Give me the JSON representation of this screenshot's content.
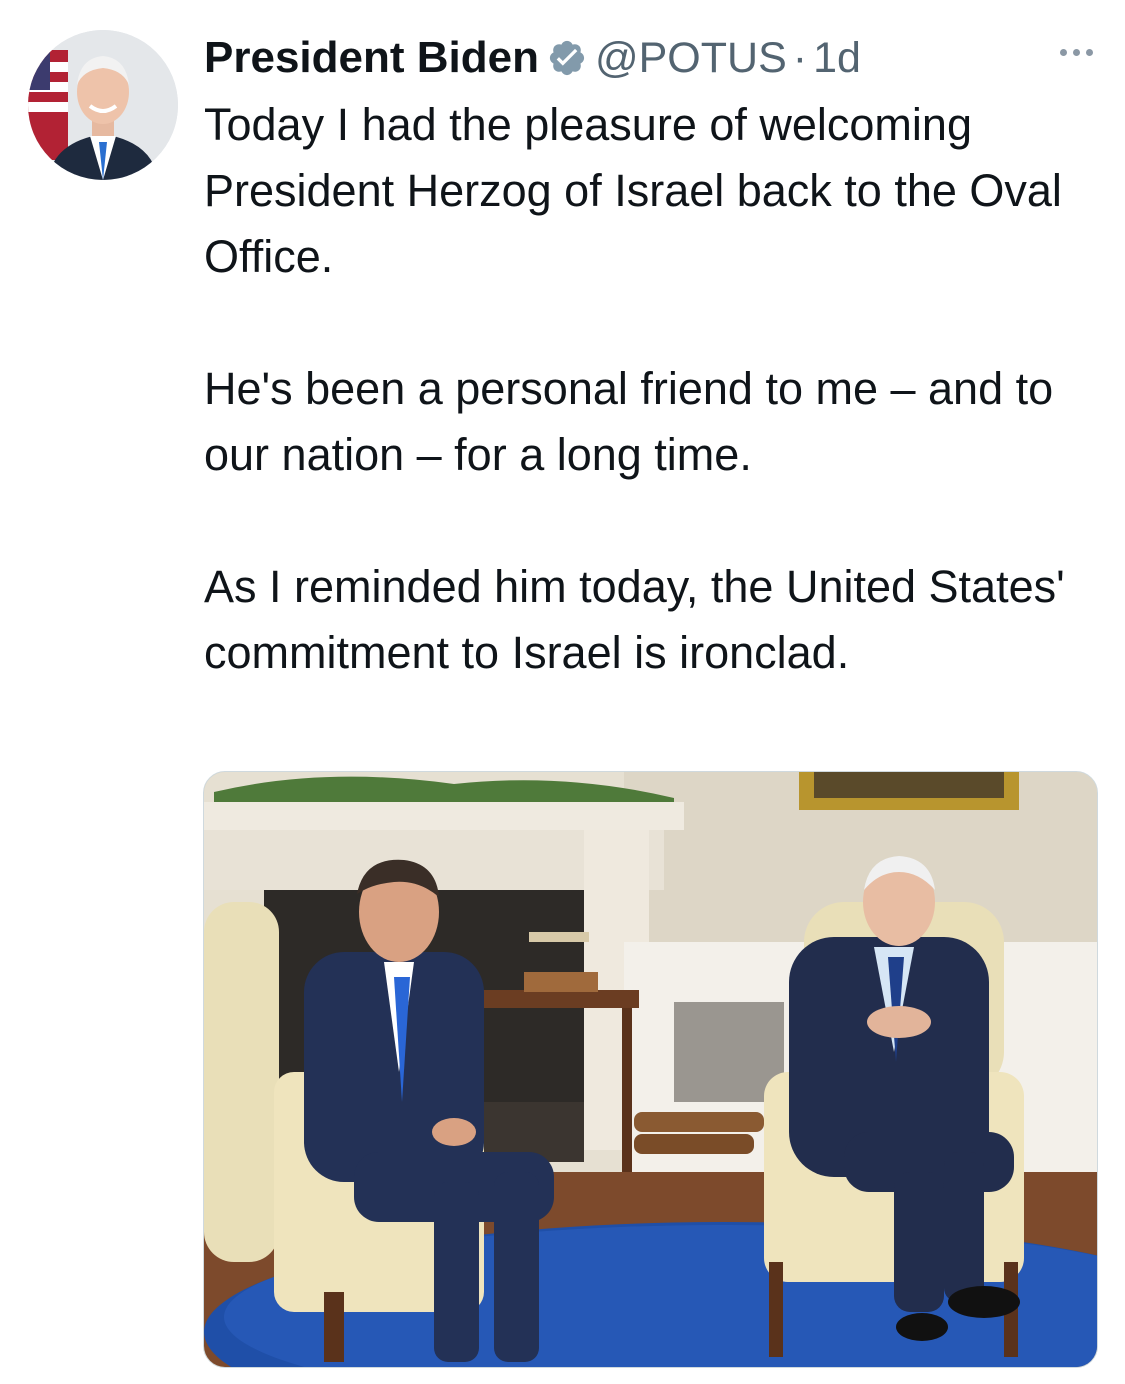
{
  "tweet": {
    "author_name": "President Biden",
    "author_handle": "@POTUS",
    "separator": "·",
    "time": "1d",
    "verified_icon": "verified-badge-icon",
    "paragraphs": [
      "Today I had the pleasure of welcoming President Herzog of Israel back to the Oval Office.",
      "He's been a personal friend to me – and to our nation – for a long time.",
      "As I reminded him today, the United States' commitment to Israel is ironclad."
    ]
  },
  "colors": {
    "text": "#0f1419",
    "secondary": "#536471",
    "verified": "#829aab"
  }
}
